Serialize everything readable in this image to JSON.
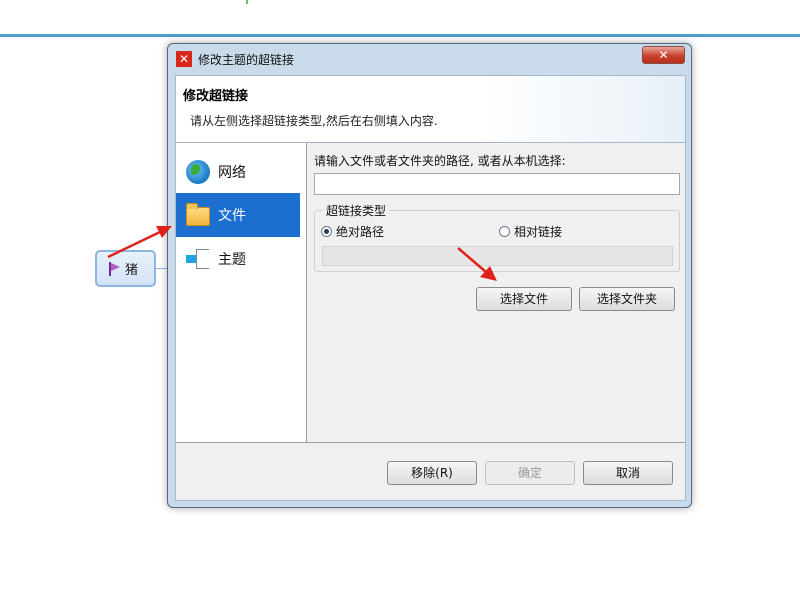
{
  "canvas": {
    "topic_label": "猪",
    "accent_color": "#4a9fd0"
  },
  "dialog": {
    "title": "修改主题的超链接",
    "close_label": "✕",
    "header": {
      "title": "修改超链接",
      "description": "请从左侧选择超链接类型,然后在右侧填入内容."
    },
    "sidebar": {
      "items": [
        {
          "label": "网络",
          "icon": "globe-icon",
          "selected": false
        },
        {
          "label": "文件",
          "icon": "folder-icon",
          "selected": true
        },
        {
          "label": "主题",
          "icon": "topic-icon",
          "selected": false
        }
      ],
      "selected_color": "#1c6ecf"
    },
    "file_panel": {
      "prompt": "请输入文件或者文件夹的路径, 或者从本机选择:",
      "path_value": "",
      "link_type_group": "超链接类型",
      "absolute_label": "绝对路径",
      "relative_label": "相对链接",
      "selected_type": "绝对路径",
      "choose_file_label": "选择文件",
      "choose_folder_label": "选择文件夹"
    },
    "footer": {
      "remove_label": "移除(R)",
      "ok_label": "确定",
      "cancel_label": "取消"
    }
  },
  "annotations": {
    "arrow_color": "#e0221a"
  }
}
